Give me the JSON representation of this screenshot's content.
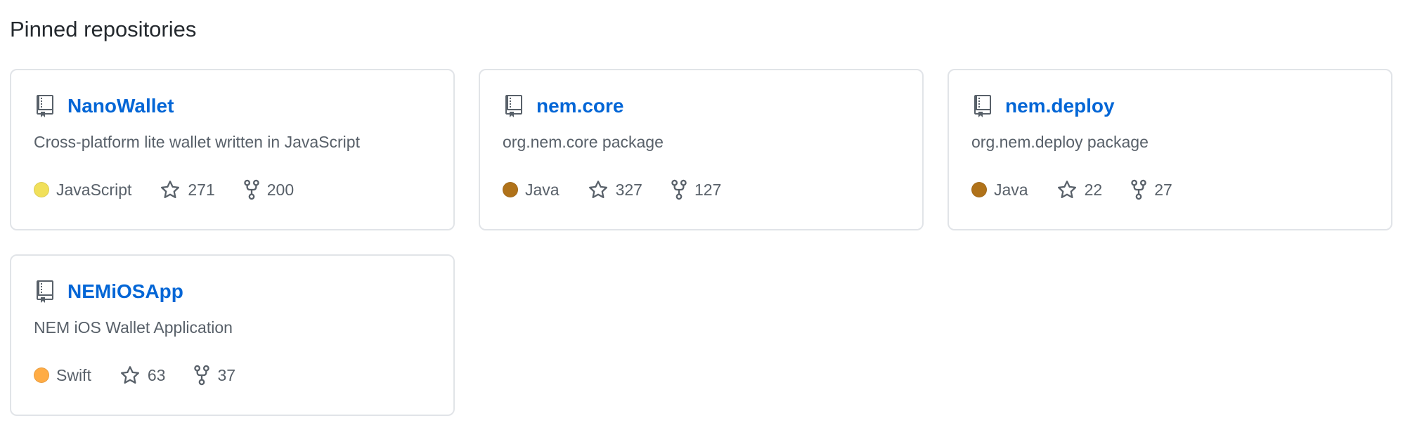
{
  "section": {
    "title": "Pinned repositories"
  },
  "repos": [
    {
      "name": "NanoWallet",
      "description": "Cross-platform lite wallet written in JavaScript",
      "language": "JavaScript",
      "language_color": "#f1e05a",
      "stars": "271",
      "forks": "200"
    },
    {
      "name": "nem.core",
      "description": "org.nem.core package",
      "language": "Java",
      "language_color": "#b07219",
      "stars": "327",
      "forks": "127"
    },
    {
      "name": "nem.deploy",
      "description": "org.nem.deploy package",
      "language": "Java",
      "language_color": "#b07219",
      "stars": "22",
      "forks": "27"
    },
    {
      "name": "NEMiOSApp",
      "description": "NEM iOS Wallet Application",
      "language": "Swift",
      "language_color": "#ffac45",
      "stars": "63",
      "forks": "37"
    }
  ],
  "colors": {
    "link": "#0366d6",
    "muted_text": "#586069",
    "border": "#e1e4e8"
  },
  "icons": {
    "repo": "repo-icon",
    "star": "star-icon",
    "fork": "fork-icon"
  }
}
